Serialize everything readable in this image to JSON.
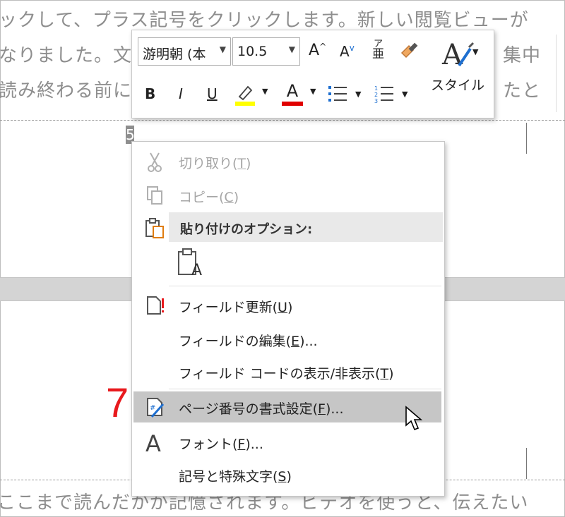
{
  "document": {
    "lines_top": [
      "ックして、プラス記号をクリックします。新しい閲覧ビューが",
      "なりました。文",
      "集中",
      "読み終わる前に",
      "たと"
    ],
    "line_bottom": "ここまで読んだかが記憶されます。ビデオを使うと、伝えたい",
    "field_text": "5"
  },
  "mini_toolbar": {
    "font_name": "游明朝 (本",
    "font_size": "10.5",
    "grow_font": "A",
    "shrink_font": "A",
    "phonetic_top": "ア",
    "phonetic_bottom": "亜",
    "bold": "B",
    "italic": "I",
    "underline": "U",
    "font_color": "A",
    "styles_label": "スタイル",
    "highlight_color": "#ffff00",
    "font_color_bar": "#e00000"
  },
  "context_menu": {
    "items": [
      {
        "label": "切り取り(",
        "key": "T",
        "tail": ")",
        "icon": "scissors-icon",
        "enabled": false
      },
      {
        "label": "コピー(",
        "key": "C",
        "tail": ")",
        "icon": "copy-icon",
        "enabled": false
      },
      {
        "label": "フィールド更新(",
        "key": "U",
        "tail": ")",
        "icon": "update-field-icon",
        "enabled": true
      },
      {
        "label": "フィールドの編集(",
        "key": "E",
        "tail": ")...",
        "icon": "",
        "enabled": true
      },
      {
        "label": "フィールド コードの表示/非表示(",
        "key": "T",
        "tail": ")",
        "icon": "",
        "enabled": true
      },
      {
        "label": "ページ番号の書式設定(",
        "key": "F",
        "tail": ")...",
        "icon": "page-number-format-icon",
        "enabled": true,
        "highlighted": true
      },
      {
        "label": "フォント(",
        "key": "F",
        "tail": ")...",
        "icon": "font-icon",
        "enabled": true
      },
      {
        "label": "記号と特殊文字(",
        "key": "S",
        "tail": ")",
        "icon": "",
        "enabled": true
      }
    ],
    "paste_options_header": "貼り付けのオプション:",
    "paste_keep_text": "A"
  },
  "annotation": {
    "step_number": "7"
  },
  "colors": {
    "highlight_row": "#c6c6c6",
    "step_number": "#e8191d",
    "disabled_text": "#a6a6a6"
  }
}
